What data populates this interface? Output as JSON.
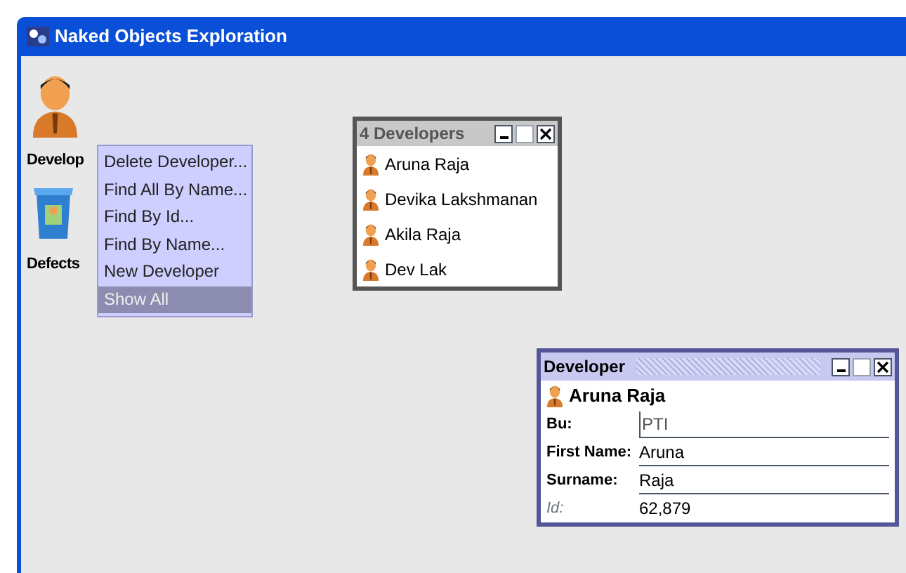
{
  "window": {
    "title": "Naked Objects Exploration"
  },
  "desktop_icons": [
    {
      "label": "Develop",
      "kind": "person"
    },
    {
      "label": "Defects",
      "kind": "bin"
    }
  ],
  "context_menu": {
    "items": [
      {
        "label": "Delete Developer...",
        "selected": false
      },
      {
        "label": "Find All By Name...",
        "selected": false
      },
      {
        "label": "Find By Id...",
        "selected": false
      },
      {
        "label": "Find By Name...",
        "selected": false
      },
      {
        "label": "New Developer",
        "selected": false
      },
      {
        "label": "Show All",
        "selected": true
      }
    ]
  },
  "list_window": {
    "title": "4 Developers",
    "items": [
      "Aruna Raja",
      "Devika Lakshmanan",
      "Akila Raja",
      "Dev Lak"
    ]
  },
  "object_window": {
    "title": "Developer",
    "object": "Aruna Raja",
    "fields": [
      {
        "label": "Bu:",
        "value": "PTI",
        "kind": "editable"
      },
      {
        "label": "First Name:",
        "value": "Aruna",
        "kind": "editable"
      },
      {
        "label": "Surname:",
        "value": "Raja",
        "kind": "editable"
      },
      {
        "label": "Id:",
        "value": "62,879",
        "kind": "readonly"
      }
    ]
  }
}
